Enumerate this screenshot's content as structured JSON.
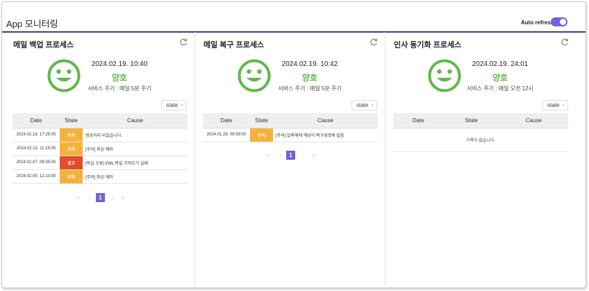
{
  "app_title": "App 모니터링",
  "auto_refresh": {
    "label": "Auto refresh",
    "enabled": true
  },
  "columns": {
    "date": "Date",
    "state": "State",
    "cause": "Cause"
  },
  "pager": {
    "first": "«",
    "prev": "‹",
    "current": "1",
    "next": "›",
    "last": "»"
  },
  "panels": [
    {
      "title": "메일 백업 프로세스",
      "time": "2024.02.19. 10:40",
      "status": "양호",
      "cycle": "서비스 주기 : 매일 5분 주기",
      "filter": "state",
      "rows": [
        {
          "date": "2024.02.16. 17:25:00",
          "state": "주의",
          "cause": "정상처리 되었습니다.",
          "level": "warn"
        },
        {
          "date": "2024.02.12. 11:15:00",
          "state": "주의",
          "cause": "[주의] 파싱 에러",
          "level": "warn"
        },
        {
          "date": "2024.02.07. 09:35:00",
          "state": "경고",
          "cause": "[파일 오류] EML 파일 가져오기 실패",
          "level": "alert"
        },
        {
          "date": "2024.02.05. 12:10:00",
          "state": "주의",
          "cause": "[주의] 파싱 에러",
          "level": "warn"
        }
      ]
    },
    {
      "title": "메일 복구 프로세스",
      "time": "2024.02.19. 10:42",
      "status": "양호",
      "cycle": "서비스 주기 : 매일 5분 주기",
      "filter": "state",
      "rows": [
        {
          "date": "2024.01.26. 08:59:00",
          "state": "주의",
          "cause": "[주의] 압축해제 해당이 복구경로에 없음",
          "level": "warn"
        }
      ]
    },
    {
      "title": "인사 동기화 프로세스",
      "time": "2024.02.19. 24:01",
      "status": "양호",
      "cycle": "서비스 주기 : 매일 오전 12시",
      "filter": "state",
      "rows": [],
      "empty_text": "기록이 없습니다."
    }
  ],
  "colors": {
    "accent": "#6d64dc",
    "good": "#5fb84a",
    "warn": "#f4b23c",
    "alert": "#e64b2a",
    "header_rule": "#3c3c8c"
  }
}
